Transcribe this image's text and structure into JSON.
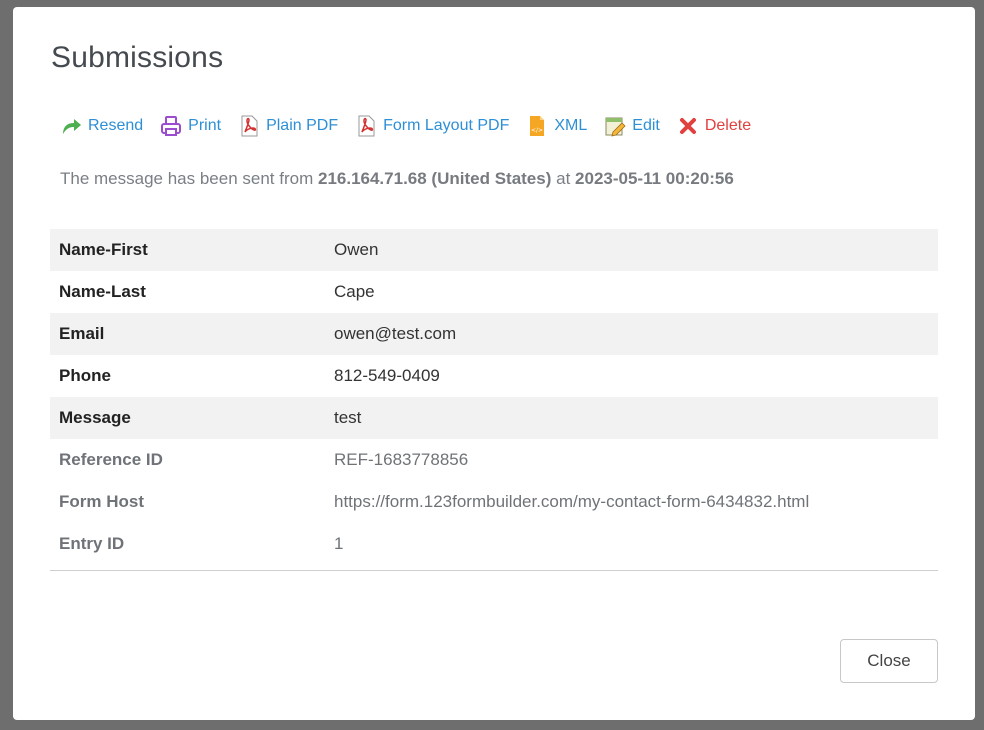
{
  "modal": {
    "title": "Submissions"
  },
  "toolbar": [
    {
      "label": "Resend",
      "icon": "resend-arrow-icon",
      "color": "#2d8fd6"
    },
    {
      "label": "Print",
      "icon": "printer-icon",
      "color": "#2d8fd6"
    },
    {
      "label": "Plain PDF",
      "icon": "pdf-icon",
      "color": "#2d8fd6"
    },
    {
      "label": "Form Layout PDF",
      "icon": "pdf-icon",
      "color": "#2d8fd6"
    },
    {
      "label": "XML",
      "icon": "xml-file-icon",
      "color": "#2d8fd6"
    },
    {
      "label": "Edit",
      "icon": "edit-icon",
      "color": "#2d8fd6"
    },
    {
      "label": "Delete",
      "icon": "delete-x-icon",
      "color": "#e0413e"
    }
  ],
  "sent": {
    "prefix": "The message has been sent from",
    "ip": "216.164.71.68 (United States)",
    "at": "at",
    "datetime": "2023-05-11 00:20:56"
  },
  "fields": [
    {
      "label": "Name-First",
      "value": "Owen"
    },
    {
      "label": "Name-Last",
      "value": "Cape"
    },
    {
      "label": "Email",
      "value": "owen@test.com"
    },
    {
      "label": "Phone",
      "value": "812-549-0409"
    },
    {
      "label": "Message",
      "value": "test"
    },
    {
      "label": "Reference ID",
      "value": "REF-1683778856"
    },
    {
      "label": "Form Host",
      "value": "https://form.123formbuilder.com/my-contact-form-6434832.html"
    },
    {
      "label": "Entry ID",
      "value": "1"
    }
  ],
  "close_label": "Close",
  "colors": {
    "link": "#2d8fd6",
    "danger": "#e0413e",
    "backdrop": "#6e6e6e"
  }
}
